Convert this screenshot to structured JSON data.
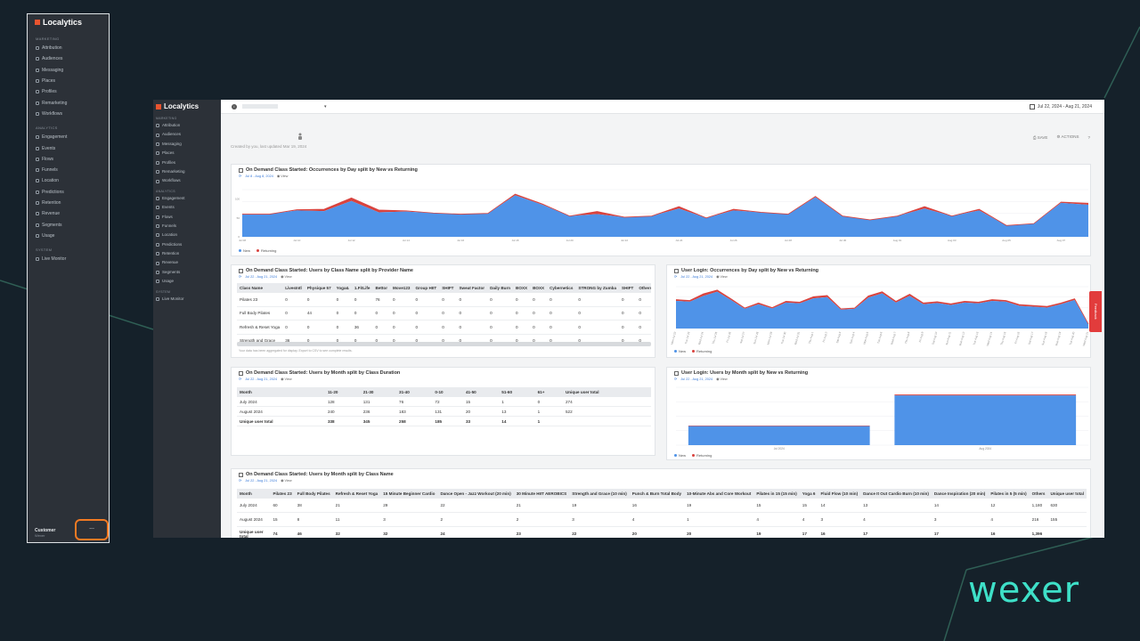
{
  "brand": {
    "name": "Localytics",
    "footer_logo": "wexer"
  },
  "nav": {
    "marketing_section": "MARKETING",
    "analytics_section": "ANALYTICS",
    "system_section": "SYSTEM",
    "marketing_items": [
      "Attribution",
      "Audiences",
      "Messaging",
      "Places",
      "Profiles",
      "Remarketing",
      "Workflows"
    ],
    "analytics_items": [
      "Engagement",
      "Events",
      "Flows",
      "Funnels",
      "Location",
      "Predictions",
      "Retention",
      "Revenue",
      "Segments",
      "Usage"
    ],
    "system_items": [
      "Live Monitor"
    ],
    "customer_label": "Customer",
    "customer_sub": "Wexer",
    "more_button": "..."
  },
  "topbar": {
    "date_range": "Jul 22, 2024 - Aug 21, 2024",
    "caret": "▾",
    "info": "i"
  },
  "dashboard": {
    "meta": "Created by you, last updated Mar 19, 2024",
    "save": "SAVE",
    "actions": "ACTIONS",
    "help": "?"
  },
  "feedback": "Feedback",
  "cards": {
    "c1": {
      "title": "On Demand Class Started: Occurrences by Day split by New vs Returning",
      "dates": "Jul 8 - Aug 8, 2024",
      "view": "View"
    },
    "c2": {
      "title": "On Demand Class Started: Users by Class Name split by Provider Name",
      "dates": "Jul 22 - Aug 21, 2024",
      "view": "View",
      "note": "Your data has been aggregated for display. Export to CSV to see complete results."
    },
    "c3": {
      "title": "User Login: Occurrences by Day split by New vs Returning",
      "dates": "Jul 22 - Aug 21, 2024",
      "view": "View"
    },
    "c4": {
      "title": "On Demand Class Started: Users by Month split by Class Duration",
      "dates": "Jul 22 - Aug 21, 2024",
      "view": "View"
    },
    "c5": {
      "title": "User Login: Users by Month split by New vs Returning",
      "dates": "Jul 22 - Aug 21, 2024",
      "view": "View"
    },
    "c6": {
      "title": "On Demand Class Started: Users by Month split by Class Name",
      "dates": "Jul 22 - Aug 21, 2024",
      "view": "View"
    }
  },
  "legend": {
    "new": "New",
    "returning": "Returning"
  },
  "colors": {
    "new": "#4f93e8",
    "returning": "#d9433e",
    "accent_orange": "#f27a23",
    "brand_teal": "#3ee0c8"
  },
  "table_class_provider": {
    "headers": [
      "Class Name",
      "LivesIntl",
      "Physique 57",
      "Yoga&",
      "1.FitLife",
      "Bettor",
      "Move123",
      "Group HIIT",
      "SHIFT",
      "Sweat Factor",
      "Daily Burn",
      "BOXX",
      "BOXX",
      "Cybernetics",
      "STRONG by Zumba",
      "SHIFT",
      "Others"
    ],
    "rows": [
      [
        "Pilates 23",
        "0",
        "0",
        "0",
        "0",
        "76",
        "0",
        "0",
        "0",
        "0",
        "0",
        "0",
        "0",
        "0",
        "0",
        "0",
        "0"
      ],
      [
        "Full Body Pilates",
        "0",
        "44",
        "0",
        "0",
        "0",
        "0",
        "0",
        "0",
        "0",
        "0",
        "0",
        "0",
        "0",
        "0",
        "0",
        "0"
      ],
      [
        "Refresh & Reset Yoga",
        "0",
        "0",
        "0",
        "36",
        "0",
        "0",
        "0",
        "0",
        "0",
        "0",
        "0",
        "0",
        "0",
        "0",
        "0",
        "0"
      ],
      [
        "Strength and Grace",
        "36",
        "0",
        "0",
        "0",
        "0",
        "0",
        "0",
        "0",
        "0",
        "0",
        "0",
        "0",
        "0",
        "0",
        "0",
        "0"
      ]
    ]
  },
  "table_duration": {
    "headers": [
      "Month",
      "11-20",
      "21-30",
      "31-40",
      "0-10",
      "41-50",
      "51-60",
      "61+",
      "Unique user total"
    ],
    "rows": [
      [
        "July 2024",
        "128",
        "131",
        "76",
        "72",
        "15",
        "1",
        "0",
        "274"
      ],
      [
        "August 2024",
        "240",
        "236",
        "183",
        "131",
        "20",
        "13",
        "1",
        "522"
      ],
      [
        "Unique user total",
        "338",
        "345",
        "258",
        "185",
        "33",
        "14",
        "1",
        ""
      ]
    ]
  },
  "table_class_month": {
    "headers": [
      "Month",
      "Pilates 23",
      "Full Body Pilates",
      "Refresh & Reset Yoga",
      "15 Minute Beginner Cardio",
      "Dance Open - Jazz Workout (20 min)",
      "30 Minute HIIT AEROBICS",
      "Strength and Grace (10 min)",
      "Punch & Burn Total Body",
      "10-Minute Abs and Core Workout",
      "Pilates in 15 (15 min)",
      "Yoga 6",
      "Fluid Flow (10 min)",
      "Dance It Out Cardio Burn (10 min)",
      "Dance Inspiration (20 min)",
      "Pilates in 5 (5 min)",
      "Others",
      "Unique user total"
    ],
    "rows": [
      [
        "July 2024",
        "60",
        "38",
        "21",
        "29",
        "22",
        "21",
        "19",
        "16",
        "19",
        "15",
        "15",
        "14",
        "13",
        "14",
        "12",
        "1,180",
        "630"
      ],
      [
        "August 2024",
        "15",
        "8",
        "11",
        "3",
        "2",
        "2",
        "3",
        "4",
        "1",
        "4",
        "4",
        "3",
        "4",
        "3",
        "4",
        "216",
        "155"
      ],
      [
        "Unique user total",
        "74",
        "46",
        "32",
        "32",
        "24",
        "23",
        "22",
        "20",
        "20",
        "19",
        "17",
        "16",
        "17",
        "17",
        "16",
        "1,396",
        ""
      ]
    ]
  },
  "chart_data": [
    {
      "type": "area",
      "title": "On Demand Class Started: Occurrences by Day split by New vs Returning",
      "x": [
        "Jul 08",
        "Jul 09",
        "Jul 10",
        "Jul 11",
        "Jul 12",
        "Jul 13",
        "Jul 14",
        "Jul 15",
        "Jul 16",
        "Jul 17",
        "Jul 18",
        "Jul 19",
        "Jul 20",
        "Jul 21",
        "Jul 22",
        "Jul 23",
        "Jul 24",
        "Jul 25",
        "Jul 26",
        "Jul 27",
        "Jul 28",
        "Jul 29",
        "Jul 30",
        "Jul 31",
        "Aug 01",
        "Aug 02",
        "Aug 03",
        "Aug 04",
        "Aug 05",
        "Aug 06",
        "Aug 07",
        "Aug 08"
      ],
      "series": [
        {
          "name": "New",
          "values": [
            60,
            60,
            70,
            68,
            95,
            65,
            67,
            63,
            60,
            62,
            110,
            85,
            55,
            60,
            52,
            55,
            75,
            50,
            70,
            65,
            60,
            105,
            55,
            45,
            55,
            75,
            55,
            70,
            30,
            35,
            90,
            85
          ]
        },
        {
          "name": "Returning",
          "values": [
            0,
            0,
            2,
            5,
            8,
            6,
            2,
            0,
            0,
            0,
            3,
            2,
            0,
            7,
            0,
            0,
            5,
            0,
            3,
            0,
            0,
            2,
            0,
            0,
            0,
            5,
            0,
            3,
            0,
            0,
            2,
            4
          ]
        }
      ],
      "yticks": [
        0,
        50,
        100
      ],
      "ylim": [
        0,
        125
      ]
    },
    {
      "type": "area",
      "title": "User Login: Occurrences by Day split by New vs Returning",
      "x": [
        "Mon Jul 22",
        "Tue Jul 23",
        "Wed Jul 24",
        "Thu Jul 25",
        "Fri Jul 26",
        "Sat Jul 27",
        "Sun Jul 28",
        "Mon Jul 29",
        "Tue Jul 30",
        "Wed Jul 31",
        "Thu Aug 1",
        "Fri Aug 2",
        "Sat Aug 3",
        "Sun Aug 4",
        "Mon Aug 5",
        "Tue Aug 6",
        "Wed Aug 7",
        "Thu Aug 8",
        "Fri Aug 9",
        "Sat Aug 10",
        "Sun Aug 11",
        "Mon Aug 12",
        "Tue Aug 13",
        "Wed Aug 14",
        "Thu Aug 15",
        "Fri Aug 16",
        "Sat Aug 17",
        "Sun Aug 18",
        "Mon Aug 19",
        "Tue Aug 20",
        "Wed Aug 21"
      ],
      "series": [
        {
          "name": "New",
          "values": [
            66,
            64,
            78,
            88,
            68,
            47,
            58,
            48,
            62,
            60,
            72,
            75,
            45,
            47,
            74,
            84,
            62,
            78,
            58,
            61,
            56,
            62,
            60,
            66,
            64,
            54,
            52,
            50,
            58,
            68,
            10
          ]
        },
        {
          "name": "Returning",
          "values": [
            3,
            3,
            5,
            4,
            3,
            2,
            3,
            2,
            3,
            3,
            4,
            4,
            2,
            2,
            4,
            4,
            3,
            4,
            3,
            3,
            3,
            3,
            3,
            3,
            3,
            3,
            3,
            3,
            3,
            3,
            1
          ]
        }
      ],
      "ylim": [
        0,
        100
      ]
    },
    {
      "type": "bar",
      "title": "User Login: Users by Month split by New vs Returning",
      "categories": [
        "Jul 2024",
        "Aug 2024"
      ],
      "series": [
        {
          "name": "New",
          "values": [
            330,
            860
          ]
        },
        {
          "name": "Returning",
          "values": [
            8,
            15
          ]
        }
      ],
      "ylim": [
        0,
        1000
      ]
    }
  ]
}
